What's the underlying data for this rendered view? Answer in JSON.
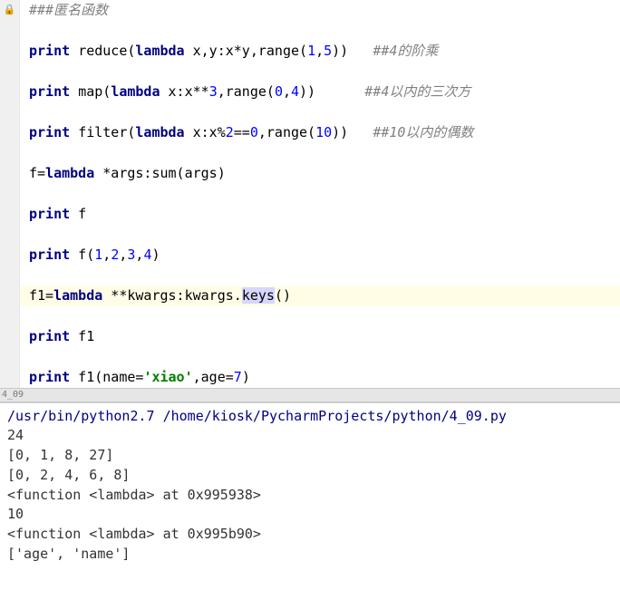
{
  "editor": {
    "lines": [
      {
        "type": "locked",
        "comment": "###匿名函数"
      },
      {
        "type": "blank"
      },
      {
        "type": "code",
        "segments": [
          {
            "cls": "kw",
            "t": "print"
          },
          {
            "cls": "op",
            "t": " "
          },
          {
            "cls": "fn",
            "t": "reduce("
          },
          {
            "cls": "kw",
            "t": "lambda"
          },
          {
            "cls": "fn",
            "t": " x,y:x*y,range("
          },
          {
            "cls": "num",
            "t": "1"
          },
          {
            "cls": "fn",
            "t": ","
          },
          {
            "cls": "num",
            "t": "5"
          },
          {
            "cls": "fn",
            "t": "))"
          },
          {
            "cls": "op",
            "t": "   "
          },
          {
            "cls": "comment",
            "t": "##4的阶乘"
          }
        ]
      },
      {
        "type": "blank"
      },
      {
        "type": "code",
        "segments": [
          {
            "cls": "kw",
            "t": "print"
          },
          {
            "cls": "op",
            "t": " "
          },
          {
            "cls": "fn",
            "t": "map("
          },
          {
            "cls": "kw",
            "t": "lambda"
          },
          {
            "cls": "fn",
            "t": " x:x**"
          },
          {
            "cls": "num",
            "t": "3"
          },
          {
            "cls": "fn",
            "t": ",range("
          },
          {
            "cls": "num",
            "t": "0"
          },
          {
            "cls": "fn",
            "t": ","
          },
          {
            "cls": "num",
            "t": "4"
          },
          {
            "cls": "fn",
            "t": "))"
          },
          {
            "cls": "op",
            "t": "      "
          },
          {
            "cls": "comment",
            "t": "##4以内的三次方"
          }
        ]
      },
      {
        "type": "blank"
      },
      {
        "type": "code",
        "segments": [
          {
            "cls": "kw",
            "t": "print"
          },
          {
            "cls": "op",
            "t": " "
          },
          {
            "cls": "fn",
            "t": "filter("
          },
          {
            "cls": "kw",
            "t": "lambda"
          },
          {
            "cls": "fn",
            "t": " x:x%"
          },
          {
            "cls": "num",
            "t": "2"
          },
          {
            "cls": "fn",
            "t": "=="
          },
          {
            "cls": "num",
            "t": "0"
          },
          {
            "cls": "fn",
            "t": ",range("
          },
          {
            "cls": "num",
            "t": "10"
          },
          {
            "cls": "fn",
            "t": "))"
          },
          {
            "cls": "op",
            "t": "   "
          },
          {
            "cls": "comment",
            "t": "##10以内的偶数"
          }
        ]
      },
      {
        "type": "blank"
      },
      {
        "type": "code",
        "segments": [
          {
            "cls": "fn",
            "t": "f="
          },
          {
            "cls": "kw",
            "t": "lambda"
          },
          {
            "cls": "fn",
            "t": " *args:sum(args)"
          }
        ]
      },
      {
        "type": "blank"
      },
      {
        "type": "code",
        "segments": [
          {
            "cls": "kw",
            "t": "print"
          },
          {
            "cls": "fn",
            "t": " f"
          }
        ]
      },
      {
        "type": "blank"
      },
      {
        "type": "code",
        "segments": [
          {
            "cls": "kw",
            "t": "print"
          },
          {
            "cls": "fn",
            "t": " f("
          },
          {
            "cls": "num",
            "t": "1"
          },
          {
            "cls": "fn",
            "t": ","
          },
          {
            "cls": "num",
            "t": "2"
          },
          {
            "cls": "fn",
            "t": ","
          },
          {
            "cls": "num",
            "t": "3"
          },
          {
            "cls": "fn",
            "t": ","
          },
          {
            "cls": "num",
            "t": "4"
          },
          {
            "cls": "fn",
            "t": ")"
          }
        ]
      },
      {
        "type": "blank"
      },
      {
        "type": "code",
        "highlighted": true,
        "segments": [
          {
            "cls": "fn",
            "t": "f1="
          },
          {
            "cls": "kw",
            "t": "lambda"
          },
          {
            "cls": "fn",
            "t": " **kwargs:kwargs."
          },
          {
            "cls": "fn",
            "sel": true,
            "t": "keys"
          },
          {
            "cls": "fn",
            "t": "()"
          }
        ]
      },
      {
        "type": "blank"
      },
      {
        "type": "code",
        "segments": [
          {
            "cls": "kw",
            "t": "print"
          },
          {
            "cls": "fn",
            "t": " f1"
          }
        ]
      },
      {
        "type": "blank"
      },
      {
        "type": "code",
        "segments": [
          {
            "cls": "kw",
            "t": "print"
          },
          {
            "cls": "fn",
            "t": " f1(name="
          },
          {
            "cls": "str",
            "t": "'xiao'"
          },
          {
            "cls": "fn",
            "t": ",age="
          },
          {
            "cls": "num",
            "t": "7"
          },
          {
            "cls": "fn",
            "t": ")"
          }
        ]
      }
    ]
  },
  "separator": {
    "label": "4_09"
  },
  "console": {
    "command": "/usr/bin/python2.7 /home/kiosk/PycharmProjects/python/4_09.py",
    "output": [
      "24",
      "[0, 1, 8, 27]",
      "[0, 2, 4, 6, 8]",
      "<function <lambda> at 0x995938>",
      "10",
      "<function <lambda> at 0x995b90>",
      "['age', 'name']"
    ]
  }
}
